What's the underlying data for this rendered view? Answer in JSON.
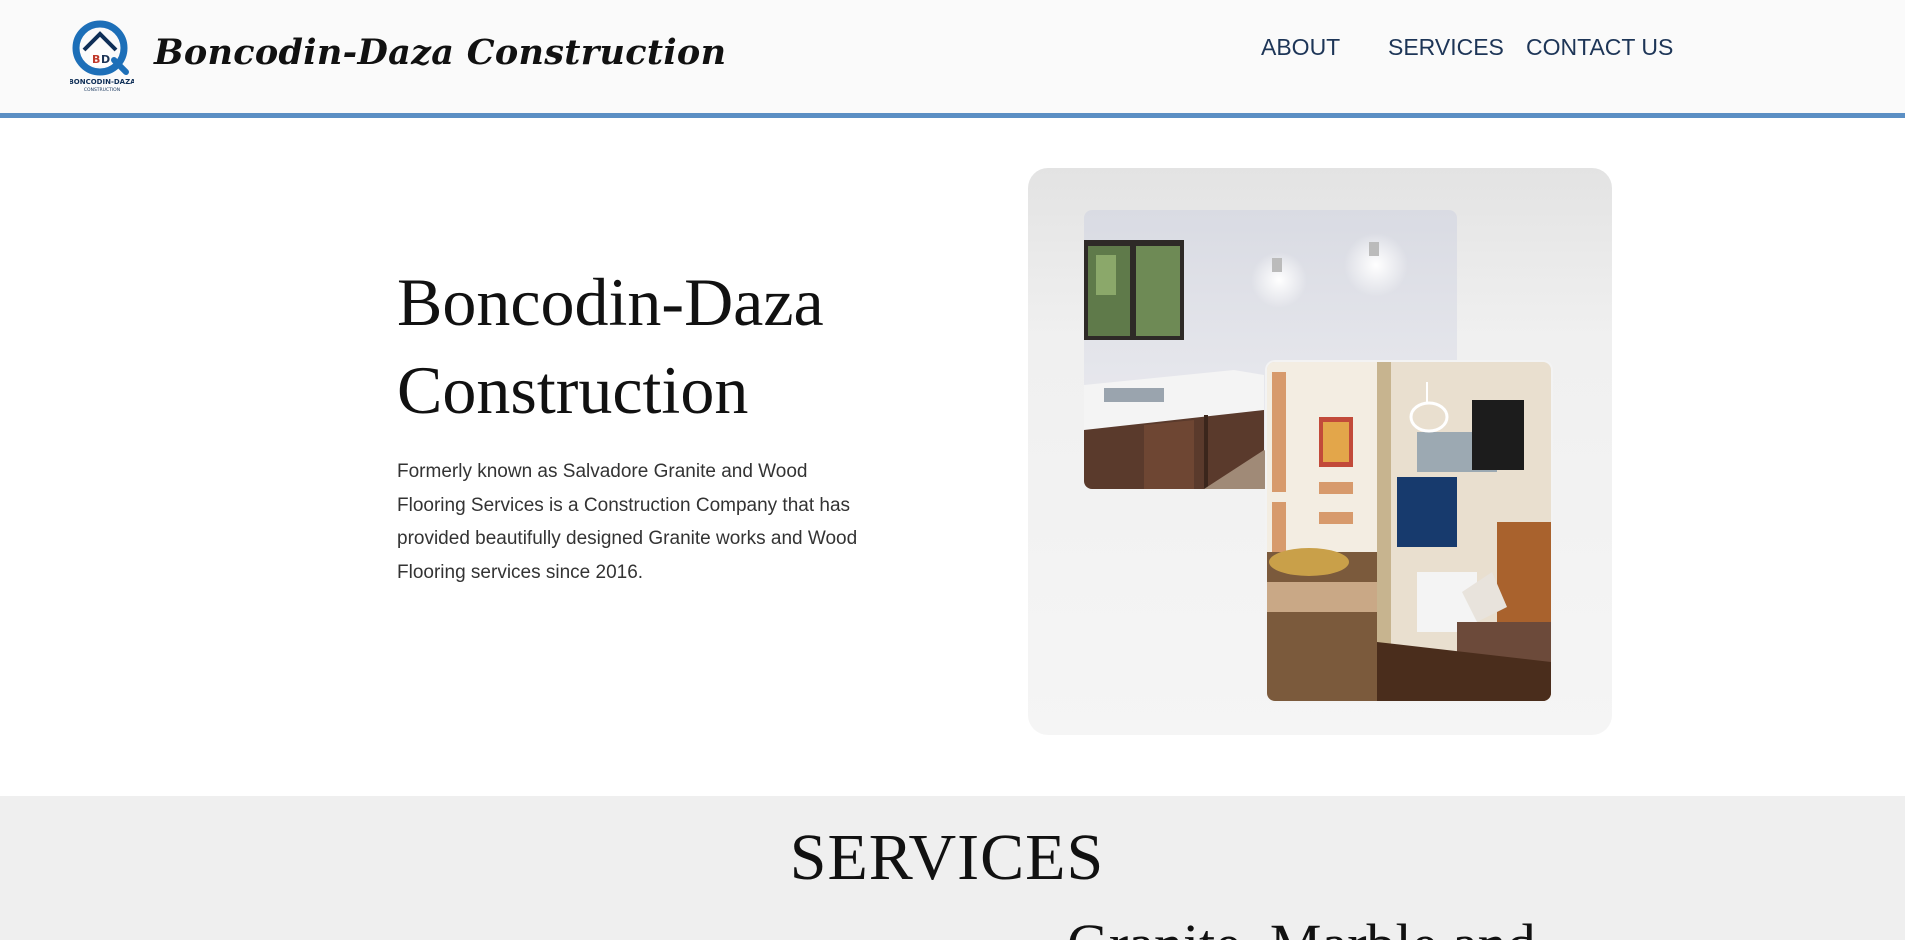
{
  "header": {
    "logo_text": "BONCODIN-DAZA CONSTRUCTION",
    "brand": "Boncodin-Daza Construction",
    "nav": {
      "about": "ABOUT",
      "services": "SERVICES",
      "contact": "CONTACT US"
    },
    "accent_color": "#5b8fc4"
  },
  "hero": {
    "title_line1": "Boncodin-Daza",
    "title_line2": "Construction",
    "description": "Formerly known as Salvadore Granite and Wood Flooring Services is a Construction Company that has provided beautifully designed Granite works and Wood Flooring services since 2016."
  },
  "services": {
    "heading": "SERVICES",
    "first_item_partial": "Granite, Marble and"
  }
}
